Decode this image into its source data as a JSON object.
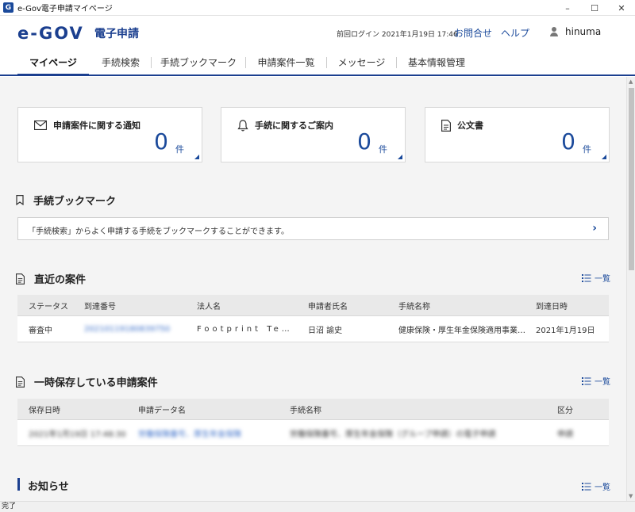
{
  "window": {
    "title": "e-Gov電子申請マイページ",
    "minimize": "–",
    "maximize": "☐",
    "close": "✕"
  },
  "header": {
    "logo": "e-GOV",
    "logo_sub": "電子申請",
    "last_login": "前回ログイン 2021年1月19日 17:46",
    "contact": "お問合せ",
    "help": "ヘルプ",
    "user": "hinuma"
  },
  "nav": {
    "tabs": [
      "マイページ",
      "手続検索",
      "手続ブックマーク",
      "申請案件一覧",
      "メッセージ",
      "基本情報管理"
    ]
  },
  "cards": [
    {
      "title": "申請案件に関する通知",
      "count": "0",
      "unit": "件",
      "icon": "mail-icon"
    },
    {
      "title": "手続に関するご案内",
      "count": "0",
      "unit": "件",
      "icon": "bell-icon"
    },
    {
      "title": "公文書",
      "count": "0",
      "unit": "件",
      "icon": "document-icon"
    }
  ],
  "bookmark": {
    "heading": "手続ブックマーク",
    "message": "「手続検索」からよく申請する手続をブックマークすることができます。",
    "chevron": "›"
  },
  "recent": {
    "heading": "直近の案件",
    "list_link": "一覧",
    "columns": [
      "ステータス",
      "到達番号",
      "法人名",
      "申請者氏名",
      "手続名称",
      "到達日時"
    ],
    "rows": [
      [
        "審査中",
        "20210119180839750",
        "Footprint Te…",
        "日沼 諭史",
        "健康保険・厚生年金保険適用事業…",
        "2021年1月19日"
      ]
    ]
  },
  "saved": {
    "heading": "一時保存している申請案件",
    "list_link": "一覧",
    "columns": [
      "保存日時",
      "申請データ名",
      "手続名称",
      "区分"
    ],
    "rows": [
      [
        "2021年1月19日 17:48:30",
        "労働保険番号、厚生年金保険",
        "労働保険番号、厚生年金保険（グループ申請）の電子申請",
        "申請"
      ]
    ]
  },
  "notices": {
    "heading": "お知らせ",
    "list_link": "一覧"
  },
  "statusbar": {
    "text": "完了"
  },
  "colors": {
    "brand": "#1b3f8f",
    "link": "#1b4a9b",
    "background": "#f4f4f4"
  }
}
